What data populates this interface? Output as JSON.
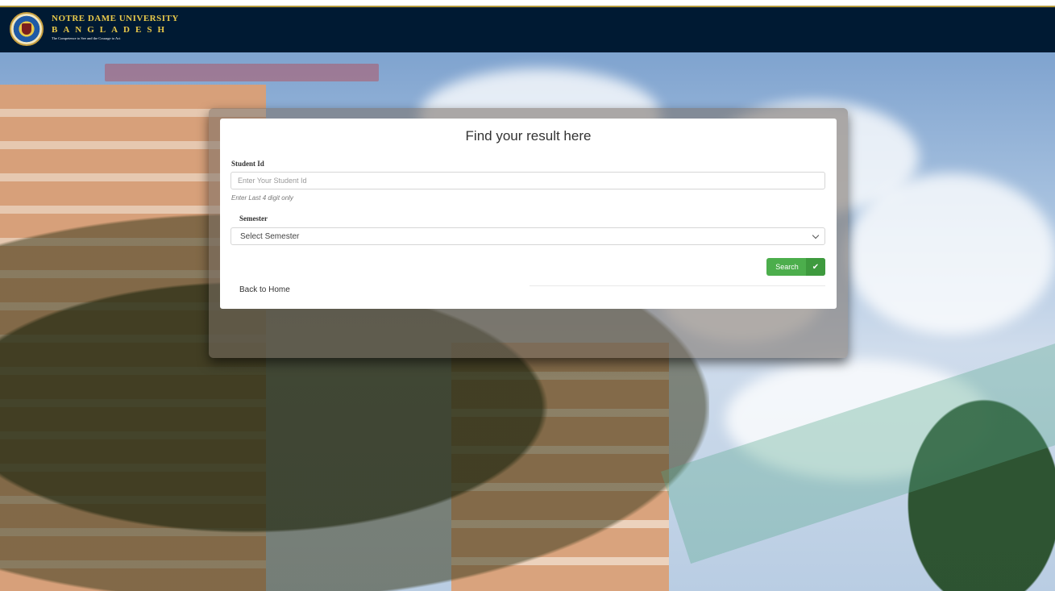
{
  "header": {
    "university_name": "NOTRE DAME UNIVERSITY",
    "country": "BANGLADESH",
    "motto": "The Competence to See and the Courage to Act"
  },
  "form": {
    "title": "Find your result here",
    "student_id": {
      "label": "Student Id",
      "placeholder": "Enter Your Student Id",
      "value": "",
      "help": "Enter Last 4 digit only"
    },
    "semester": {
      "label": "Semester",
      "selected": "Select Semester"
    },
    "search_button": {
      "label": "Search",
      "icon": "check-icon"
    },
    "back_link": "Back to Home"
  },
  "colors": {
    "header_bg": "#001a33",
    "brand_gold": "#e8c94a",
    "button_green": "#4cae4c"
  }
}
